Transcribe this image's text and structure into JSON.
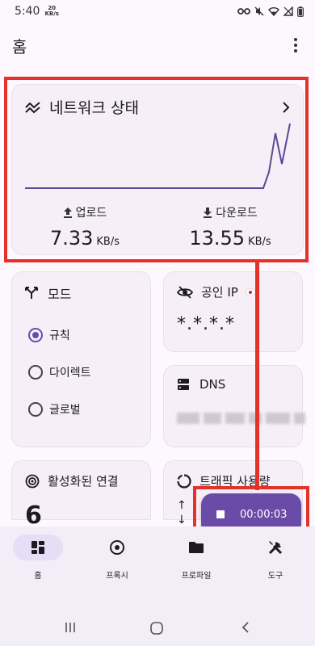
{
  "status_bar": {
    "time": "5:40",
    "speed_value": "20",
    "speed_unit": "KB/s"
  },
  "app_bar": {
    "title": "홈",
    "menu_icon": "more-vert-icon"
  },
  "network_card": {
    "title": "네트워크 상태",
    "upload_label": "업로드",
    "upload_value": "7.33",
    "upload_unit": "KB/s",
    "download_label": "다운로드",
    "download_value": "13.55",
    "download_unit": "KB/s"
  },
  "mode_card": {
    "title": "모드",
    "options": [
      {
        "label": "규칙",
        "selected": true
      },
      {
        "label": "다이렉트",
        "selected": false
      },
      {
        "label": "글로벌",
        "selected": false
      }
    ]
  },
  "ip_card": {
    "title": "공인 IP",
    "value": "*.*.*.*"
  },
  "dns_card": {
    "title": "DNS"
  },
  "connections_card": {
    "title": "활성화된 연결",
    "value": "6"
  },
  "traffic_card": {
    "title": "트래픽 사용량",
    "up_arrow": "↑",
    "down_arrow": "↓"
  },
  "timer_button": {
    "elapsed": "00:00:03"
  },
  "bottom_nav": {
    "items": [
      {
        "label": "홈",
        "icon": "dashboard-icon",
        "active": true
      },
      {
        "label": "프록시",
        "icon": "target-icon",
        "active": false
      },
      {
        "label": "프로파일",
        "icon": "folder-icon",
        "active": false
      },
      {
        "label": "도구",
        "icon": "tools-icon",
        "active": false
      }
    ]
  },
  "colors": {
    "accent": "#6a4ca8",
    "highlight": "#e53229",
    "card_bg": "#f6eff8"
  }
}
